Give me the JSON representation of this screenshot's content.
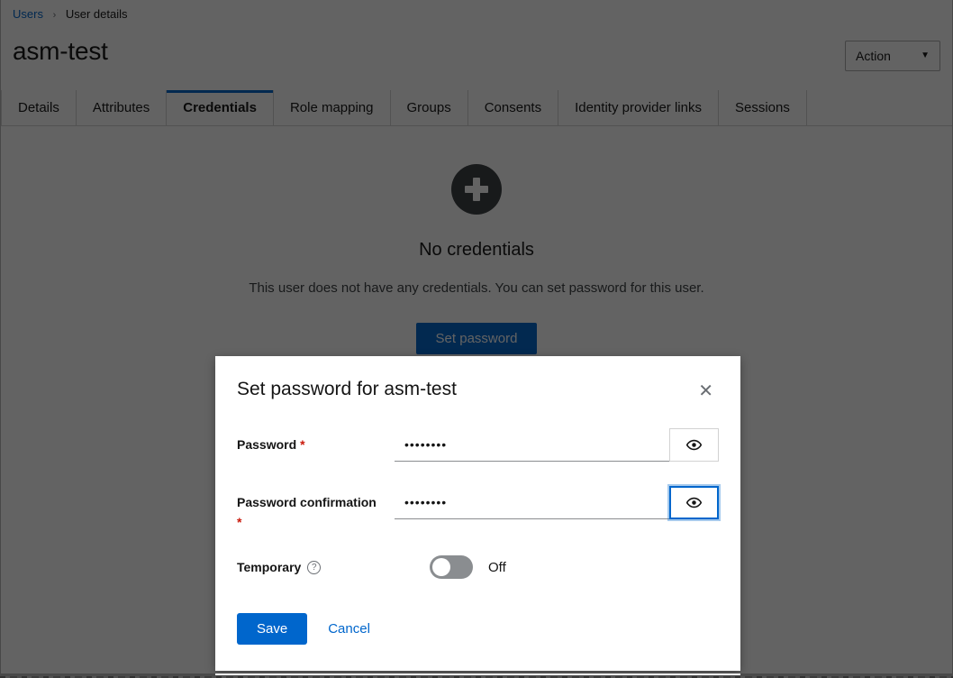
{
  "breadcrumb": {
    "parent": "Users",
    "separator": "›",
    "current": "User details"
  },
  "header": {
    "title": "asm-test",
    "action_label": "Action",
    "action_caret": "▼"
  },
  "tabs": [
    {
      "label": "Details",
      "active": false
    },
    {
      "label": "Attributes",
      "active": false
    },
    {
      "label": "Credentials",
      "active": true
    },
    {
      "label": "Role mapping",
      "active": false
    },
    {
      "label": "Groups",
      "active": false
    },
    {
      "label": "Consents",
      "active": false
    },
    {
      "label": "Identity provider links",
      "active": false
    },
    {
      "label": "Sessions",
      "active": false
    }
  ],
  "empty_state": {
    "icon": "plus-circle-icon",
    "title": "No credentials",
    "body": "This user does not have any credentials. You can set password for this user.",
    "button_label": "Set password"
  },
  "modal": {
    "title": "Set password for asm-test",
    "close_label": "✕",
    "fields": [
      {
        "label": "Password",
        "required_marker": "*",
        "value": "••••••••",
        "placeholder": "",
        "toggle_icon": "eye-icon",
        "focused": false
      },
      {
        "label": "Password confirmation",
        "required_marker": "*",
        "value": "••••••••",
        "placeholder": "",
        "toggle_icon": "eye-icon",
        "focused": true
      }
    ],
    "temporary": {
      "label": "Temporary",
      "help_icon": "?",
      "state_label": "Off",
      "checked": false
    },
    "save_label": "Save",
    "cancel_label": "Cancel"
  },
  "colors": {
    "accent_blue": "#0066cc",
    "required_red": "#c9190b",
    "toggle_off_gray": "#8a8d90",
    "backdrop": "rgba(3,3,3,0.62)"
  }
}
